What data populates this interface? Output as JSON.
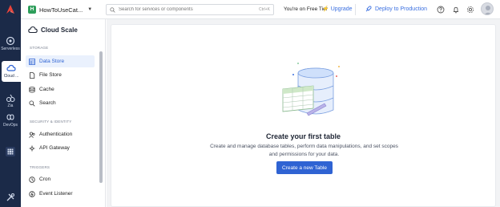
{
  "rail": {
    "items": [
      {
        "label": "Serverless",
        "icon": "serverless-icon"
      },
      {
        "label": "Cloud ...",
        "icon": "cloud-scale-icon"
      },
      {
        "label": "Zia",
        "icon": "zia-icon"
      },
      {
        "label": "DevOps",
        "icon": "devops-icon"
      }
    ],
    "apps_icon": "grid-icon",
    "settings_icon": "tools-icon"
  },
  "topbar": {
    "project_initial": "H",
    "project_name": "HowToUseCat...",
    "search_placeholder": "Search for services or components",
    "search_shortcut": "Ctrl+K",
    "tier_text": "You're on Free Tier",
    "upgrade_label": "Upgrade",
    "deploy_label": "Deploy to Production"
  },
  "side": {
    "title": "Cloud Scale",
    "sections": [
      {
        "label": "STORAGE",
        "items": [
          {
            "label": "Data Store",
            "active": true
          },
          {
            "label": "File Store"
          },
          {
            "label": "Cache"
          },
          {
            "label": "Search"
          }
        ]
      },
      {
        "label": "SECURITY & IDENTITY",
        "items": [
          {
            "label": "Authentication"
          },
          {
            "label": "API Gateway"
          }
        ]
      },
      {
        "label": "TRIGGERS",
        "items": [
          {
            "label": "Cron"
          },
          {
            "label": "Event Listener"
          }
        ]
      }
    ]
  },
  "main": {
    "empty_title": "Create your first table",
    "empty_desc": "Create and manage database tables, perform data manipulations, and set scopes and permissions for your data.",
    "create_button": "Create a new Table"
  },
  "colors": {
    "rail_bg": "#1b2a48",
    "accent": "#2f63d3",
    "active_bg": "#eaf1fd",
    "project_badge": "#2e9e5b"
  }
}
